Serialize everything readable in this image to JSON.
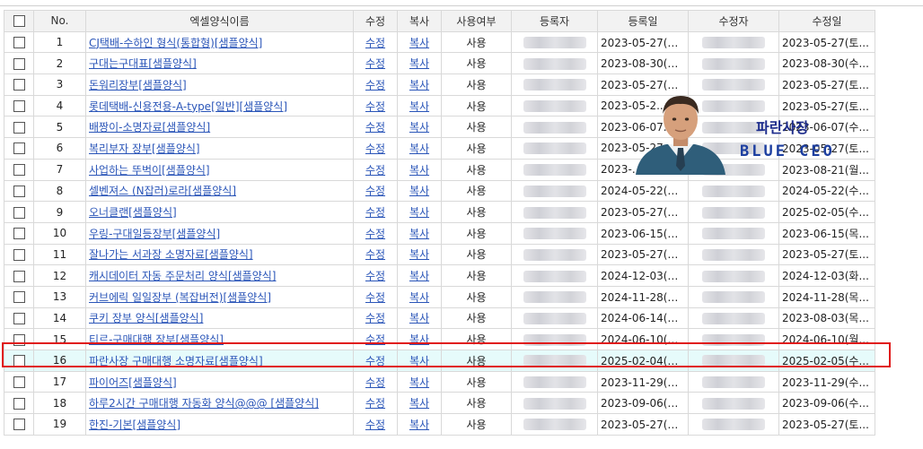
{
  "header": {
    "no": "No.",
    "name": "엑셀양식이름",
    "edit": "수정",
    "copy": "복사",
    "use": "사용여부",
    "registrant": "등록자",
    "reg_date": "등록일",
    "modifier": "수정자",
    "mod_date": "수정일"
  },
  "rows": [
    {
      "no": "1",
      "name": "CJ택배-수하인 형식(통합형)[샘플양식]",
      "edit": "수정",
      "copy": "복사",
      "use": "사용",
      "reg_date": "2023-05-27(토...",
      "mod_date": "2023-05-27(토..."
    },
    {
      "no": "2",
      "name": "구대는구대표[샘플양식]",
      "edit": "수정",
      "copy": "복사",
      "use": "사용",
      "reg_date": "2023-08-30(수...",
      "mod_date": "2023-08-30(수..."
    },
    {
      "no": "3",
      "name": "돈워리장부[샘플양식]",
      "edit": "수정",
      "copy": "복사",
      "use": "사용",
      "reg_date": "2023-05-27(토...",
      "mod_date": "2023-05-27(토..."
    },
    {
      "no": "4",
      "name": "롯데택배-신용전용-A-type[일반][샘플양식]",
      "edit": "수정",
      "copy": "복사",
      "use": "사용",
      "reg_date": "2023-05-2...",
      "mod_date": "2023-05-27(토..."
    },
    {
      "no": "5",
      "name": "배짱이-소명자료[샘플양식]",
      "edit": "수정",
      "copy": "복사",
      "use": "사용",
      "reg_date": "2023-06-07...",
      "mod_date": "2023-06-07(수..."
    },
    {
      "no": "6",
      "name": "복리부자 장부[샘플양식]",
      "edit": "수정",
      "copy": "복사",
      "use": "사용",
      "reg_date": "2023-05-27...",
      "mod_date": "2023-05-27(토..."
    },
    {
      "no": "7",
      "name": "사업하는 뚜벅이[샘플양식]",
      "edit": "수정",
      "copy": "복사",
      "use": "사용",
      "reg_date": "2023-...",
      "mod_date": "2023-08-21(월..."
    },
    {
      "no": "8",
      "name": "셀벤져스 (N잡러)로라[샘플양식]",
      "edit": "수정",
      "copy": "복사",
      "use": "사용",
      "reg_date": "2024-05-22(수...",
      "mod_date": "2024-05-22(수..."
    },
    {
      "no": "9",
      "name": "오너클랜[샘플양식]",
      "edit": "수정",
      "copy": "복사",
      "use": "사용",
      "reg_date": "2023-05-27(토...",
      "mod_date": "2025-02-05(수..."
    },
    {
      "no": "10",
      "name": "우링-구대일등장부[샘플양식]",
      "edit": "수정",
      "copy": "복사",
      "use": "사용",
      "reg_date": "2023-06-15(목...",
      "mod_date": "2023-06-15(목..."
    },
    {
      "no": "11",
      "name": "잘나가는 서과장 소명자료[샘플양식]",
      "edit": "수정",
      "copy": "복사",
      "use": "사용",
      "reg_date": "2023-05-27(토...",
      "mod_date": "2023-05-27(토..."
    },
    {
      "no": "12",
      "name": "캐시데이터 자동 주문처리 양식[샘플양식]",
      "edit": "수정",
      "copy": "복사",
      "use": "사용",
      "reg_date": "2024-12-03(화...",
      "mod_date": "2024-12-03(화..."
    },
    {
      "no": "13",
      "name": "커브에릭 일일장부 (복잡버전)[샘플양식]",
      "edit": "수정",
      "copy": "복사",
      "use": "사용",
      "reg_date": "2024-11-28(목...",
      "mod_date": "2024-11-28(목..."
    },
    {
      "no": "14",
      "name": "쿠키 장부 양식[샘플양식]",
      "edit": "수정",
      "copy": "복사",
      "use": "사용",
      "reg_date": "2024-06-14(금...",
      "mod_date": "2023-08-03(목..."
    },
    {
      "no": "15",
      "name": "티르-구매대행 장부[샘플양식]",
      "edit": "수정",
      "copy": "복사",
      "use": "사용",
      "reg_date": "2024-06-10(월...",
      "mod_date": "2024-06-10(월..."
    },
    {
      "no": "16",
      "name": "파란사장 구매대행 소명자료[샘플양식]",
      "edit": "수정",
      "copy": "복사",
      "use": "사용",
      "reg_date": "2025-02-04(화...",
      "mod_date": "2025-02-05(수..."
    },
    {
      "no": "17",
      "name": "파이어즈[샘플양식]",
      "edit": "수정",
      "copy": "복사",
      "use": "사용",
      "reg_date": "2023-11-29(수...",
      "mod_date": "2023-11-29(수..."
    },
    {
      "no": "18",
      "name": "하루2시간 구매대행 자동화 양식@@@ [샘플양식]",
      "edit": "수정",
      "copy": "복사",
      "use": "사용",
      "reg_date": "2023-09-06(수...",
      "mod_date": "2023-09-06(수..."
    },
    {
      "no": "19",
      "name": "한진-기본[샘플양식]",
      "edit": "수정",
      "copy": "복사",
      "use": "사용",
      "reg_date": "2023-05-27(토...",
      "mod_date": "2023-05-27(토..."
    }
  ],
  "highlighted_row_no": "16",
  "overlay": {
    "title": "파란사장",
    "subtitle": "BLUE CEO",
    "icon": "ceo-avatar-icon"
  },
  "colors": {
    "link": "#2a55b8",
    "highlight_bg": "#e6fbfb",
    "highlight_border": "#e01818",
    "ceo_text": "#1d2c8c"
  }
}
